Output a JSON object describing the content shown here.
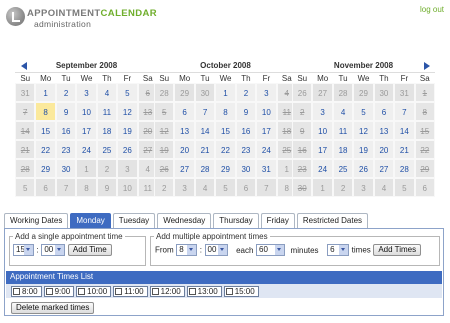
{
  "header": {
    "brand_part1": "APPOINTMENT",
    "brand_part2": "CALENDAR",
    "subtitle": "administration",
    "logout": "log out"
  },
  "colors": {
    "accent": "#3e6bc1",
    "brand_green": "#6fae2c",
    "selected_day": "#fbe99c"
  },
  "calendars": [
    {
      "title": "September 2008",
      "dows": [
        "Su",
        "Mo",
        "Tu",
        "We",
        "Th",
        "Fr",
        "Sa"
      ],
      "weeks": [
        [
          {
            "d": "31",
            "s": "out"
          },
          {
            "d": "1"
          },
          {
            "d": "2"
          },
          {
            "d": "3"
          },
          {
            "d": "4"
          },
          {
            "d": "5"
          },
          {
            "d": "6",
            "s": "struck"
          }
        ],
        [
          {
            "d": "7",
            "s": "struck"
          },
          {
            "d": "8",
            "s": "sel"
          },
          {
            "d": "9"
          },
          {
            "d": "10"
          },
          {
            "d": "11"
          },
          {
            "d": "12"
          },
          {
            "d": "13",
            "s": "struck"
          }
        ],
        [
          {
            "d": "14",
            "s": "struck"
          },
          {
            "d": "15"
          },
          {
            "d": "16"
          },
          {
            "d": "17"
          },
          {
            "d": "18"
          },
          {
            "d": "19"
          },
          {
            "d": "20",
            "s": "struck"
          }
        ],
        [
          {
            "d": "21",
            "s": "struck"
          },
          {
            "d": "22"
          },
          {
            "d": "23"
          },
          {
            "d": "24"
          },
          {
            "d": "25"
          },
          {
            "d": "26"
          },
          {
            "d": "27",
            "s": "struck"
          }
        ],
        [
          {
            "d": "28",
            "s": "struck"
          },
          {
            "d": "29"
          },
          {
            "d": "30"
          },
          {
            "d": "1",
            "s": "out"
          },
          {
            "d": "2",
            "s": "out"
          },
          {
            "d": "3",
            "s": "out"
          },
          {
            "d": "4",
            "s": "out"
          }
        ],
        [
          {
            "d": "5",
            "s": "out"
          },
          {
            "d": "6",
            "s": "out"
          },
          {
            "d": "7",
            "s": "out"
          },
          {
            "d": "8",
            "s": "out"
          },
          {
            "d": "9",
            "s": "out"
          },
          {
            "d": "10",
            "s": "out"
          },
          {
            "d": "11",
            "s": "out"
          }
        ]
      ]
    },
    {
      "title": "October 2008",
      "dows": [
        "Su",
        "Mo",
        "Tu",
        "We",
        "Th",
        "Fr",
        "Sa"
      ],
      "weeks": [
        [
          {
            "d": "28",
            "s": "out"
          },
          {
            "d": "29",
            "s": "out"
          },
          {
            "d": "30",
            "s": "out"
          },
          {
            "d": "1"
          },
          {
            "d": "2"
          },
          {
            "d": "3"
          },
          {
            "d": "4",
            "s": "struck"
          }
        ],
        [
          {
            "d": "5",
            "s": "struck"
          },
          {
            "d": "6"
          },
          {
            "d": "7"
          },
          {
            "d": "8"
          },
          {
            "d": "9"
          },
          {
            "d": "10"
          },
          {
            "d": "11",
            "s": "struck"
          }
        ],
        [
          {
            "d": "12",
            "s": "struck"
          },
          {
            "d": "13"
          },
          {
            "d": "14"
          },
          {
            "d": "15"
          },
          {
            "d": "16"
          },
          {
            "d": "17"
          },
          {
            "d": "18",
            "s": "struck"
          }
        ],
        [
          {
            "d": "19",
            "s": "struck"
          },
          {
            "d": "20"
          },
          {
            "d": "21"
          },
          {
            "d": "22"
          },
          {
            "d": "23"
          },
          {
            "d": "24"
          },
          {
            "d": "25",
            "s": "struck"
          }
        ],
        [
          {
            "d": "26",
            "s": "struck"
          },
          {
            "d": "27"
          },
          {
            "d": "28"
          },
          {
            "d": "29"
          },
          {
            "d": "30"
          },
          {
            "d": "31"
          },
          {
            "d": "1",
            "s": "out"
          }
        ],
        [
          {
            "d": "2",
            "s": "out"
          },
          {
            "d": "3",
            "s": "out"
          },
          {
            "d": "4",
            "s": "out"
          },
          {
            "d": "5",
            "s": "out"
          },
          {
            "d": "6",
            "s": "out"
          },
          {
            "d": "7",
            "s": "out"
          },
          {
            "d": "8",
            "s": "out"
          }
        ]
      ]
    },
    {
      "title": "November 2008",
      "dows": [
        "Su",
        "Mo",
        "Tu",
        "We",
        "Th",
        "Fr",
        "Sa"
      ],
      "weeks": [
        [
          {
            "d": "26",
            "s": "out"
          },
          {
            "d": "27",
            "s": "out"
          },
          {
            "d": "28",
            "s": "out"
          },
          {
            "d": "29",
            "s": "out"
          },
          {
            "d": "30",
            "s": "out"
          },
          {
            "d": "31",
            "s": "out"
          },
          {
            "d": "1",
            "s": "struck"
          }
        ],
        [
          {
            "d": "2",
            "s": "struck"
          },
          {
            "d": "3"
          },
          {
            "d": "4"
          },
          {
            "d": "5"
          },
          {
            "d": "6"
          },
          {
            "d": "7"
          },
          {
            "d": "8",
            "s": "struck"
          }
        ],
        [
          {
            "d": "9",
            "s": "struck"
          },
          {
            "d": "10"
          },
          {
            "d": "11"
          },
          {
            "d": "12"
          },
          {
            "d": "13"
          },
          {
            "d": "14"
          },
          {
            "d": "15",
            "s": "struck"
          }
        ],
        [
          {
            "d": "16",
            "s": "struck"
          },
          {
            "d": "17"
          },
          {
            "d": "18"
          },
          {
            "d": "19"
          },
          {
            "d": "20"
          },
          {
            "d": "21"
          },
          {
            "d": "22",
            "s": "struck"
          }
        ],
        [
          {
            "d": "23",
            "s": "struck"
          },
          {
            "d": "24"
          },
          {
            "d": "25"
          },
          {
            "d": "26"
          },
          {
            "d": "27"
          },
          {
            "d": "28"
          },
          {
            "d": "29",
            "s": "struck"
          }
        ],
        [
          {
            "d": "30",
            "s": "struck"
          },
          {
            "d": "1",
            "s": "out"
          },
          {
            "d": "2",
            "s": "out"
          },
          {
            "d": "3",
            "s": "out"
          },
          {
            "d": "4",
            "s": "out"
          },
          {
            "d": "5",
            "s": "out"
          },
          {
            "d": "6",
            "s": "out"
          }
        ]
      ]
    }
  ],
  "tabs": [
    {
      "label": "Working Dates"
    },
    {
      "label": "Monday",
      "active": true
    },
    {
      "label": "Tuesday"
    },
    {
      "label": "Wednesday"
    },
    {
      "label": "Thursday"
    },
    {
      "label": "Friday"
    },
    {
      "label": "Restricted Dates"
    }
  ],
  "single": {
    "legend": "Add a single appointment time",
    "hour": "15",
    "sep": ":",
    "minute": "00",
    "button": "Add Time"
  },
  "multiple": {
    "legend": "Add multiple appointment times",
    "from_label": "From",
    "hour": "8",
    "sep": ":",
    "minute": "00",
    "each_label": "each",
    "interval": "60",
    "minutes_label": "minutes",
    "count": "6",
    "times_label": "times",
    "button": "Add Times"
  },
  "times_list": {
    "header": "Appointment Times List",
    "slots": [
      "8:00",
      "9:00",
      "10:00",
      "11:00",
      "12:00",
      "13:00",
      "15:00"
    ],
    "delete_button": "Delete marked times"
  }
}
